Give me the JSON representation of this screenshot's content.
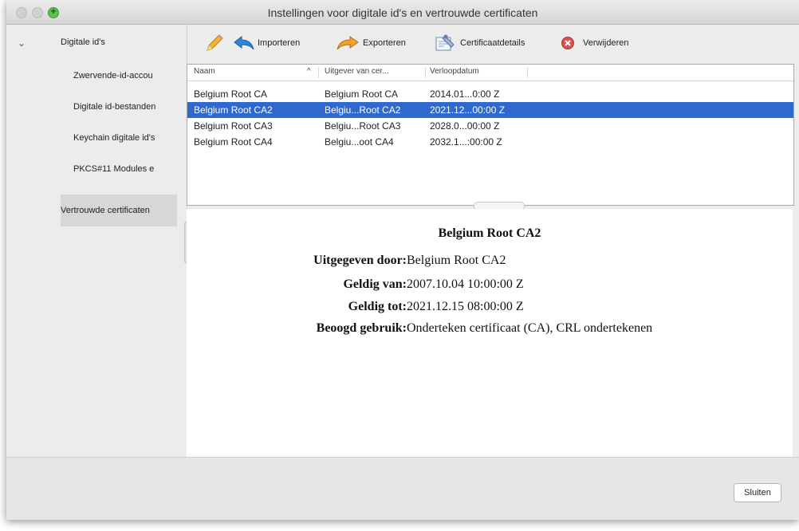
{
  "window": {
    "title": "Instellingen voor digitale id's en vertrouwde certificaten"
  },
  "sidebar": {
    "group_label": "Digitale id's",
    "items": [
      {
        "label": "Zwervende-id-accou"
      },
      {
        "label": "Digitale id-bestanden"
      },
      {
        "label": "Keychain digitale id's"
      },
      {
        "label": "PKCS#11 Modules e"
      },
      {
        "label": "Vertrouwde certificaten",
        "selected": true
      }
    ]
  },
  "toolbar": {
    "edit_icon": "pencil-icon",
    "import_label": "Importeren",
    "export_label": "Exporteren",
    "details_label": "Certificaatdetails",
    "delete_label": "Verwijderen"
  },
  "table": {
    "columns": [
      "Naam",
      "Uitgever van cer...",
      "Verloopdatum"
    ],
    "sort_indicator": "^",
    "rows": [
      {
        "name": "Belgium Root CA",
        "issuer": "Belgium Root CA",
        "expires": "2014.01...0:00 Z"
      },
      {
        "name": "Belgium Root CA2",
        "issuer": "Belgiu...Root CA2",
        "expires": "2021.12...00:00 Z"
      },
      {
        "name": "Belgium Root CA3",
        "issuer": "Belgiu...Root CA3",
        "expires": "2028.0...00:00 Z"
      },
      {
        "name": "Belgium Root CA4",
        "issuer": "Belgiu...oot CA4",
        "expires": "2032.1...:00:00 Z"
      }
    ],
    "selected_index": 1
  },
  "detail": {
    "title": "Belgium Root CA2",
    "fields": [
      {
        "label": "Uitgegeven door:",
        "value": "Belgium Root CA2"
      },
      {
        "label": "Geldig van:",
        "value": "2007.10.04 10:00:00 Z"
      },
      {
        "label": "Geldig tot:",
        "value": "2021.12.15 08:00:00 Z"
      },
      {
        "label": "Beoogd gebruik:",
        "value": "Onderteken certificaat (CA), CRL ondertekenen"
      }
    ]
  },
  "footer": {
    "close_label": "Sluiten"
  },
  "colors": {
    "selection": "#2f69ce",
    "accent_green": "#5cc04c",
    "delete_red": "#d9534f"
  }
}
